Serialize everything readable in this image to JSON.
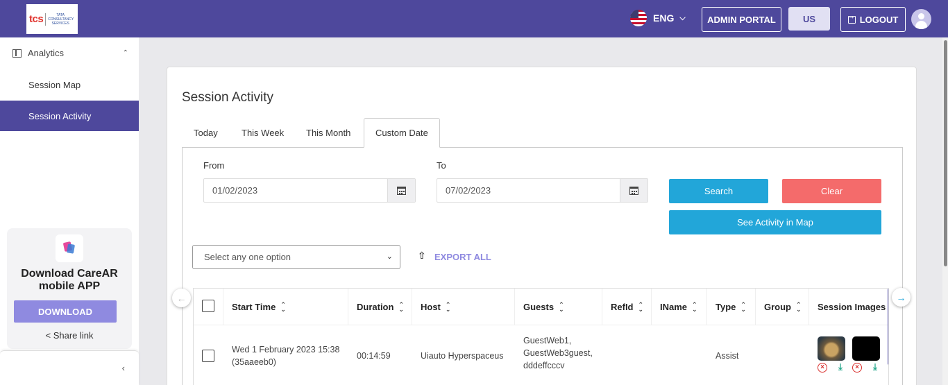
{
  "header": {
    "logo_brand": "tcs",
    "logo_tagline": "TATA CONSULTANCY SERVICES",
    "language": "ENG",
    "admin_portal": "ADMIN PORTAL",
    "region": "US",
    "logout": "LOGOUT"
  },
  "sidebar": {
    "section": "Analytics",
    "items": [
      {
        "label": "Session Map"
      },
      {
        "label": "Session Activity"
      }
    ],
    "promo_title": "Download CareAR mobile APP",
    "download_label": "DOWNLOAD",
    "share_label": "Share link"
  },
  "main": {
    "title": "Session Activity",
    "tabs": [
      {
        "label": "Today"
      },
      {
        "label": "This Week"
      },
      {
        "label": "This Month"
      },
      {
        "label": "Custom Date"
      }
    ],
    "from_label": "From",
    "from_value": "01/02/2023",
    "to_label": "To",
    "to_value": "07/02/2023",
    "search_label": "Search",
    "clear_label": "Clear",
    "map_label": "See Activity in Map",
    "select_placeholder": "Select any one option",
    "export_label": "EXPORT ALL"
  },
  "table": {
    "columns": [
      "Start Time",
      "Duration",
      "Host",
      "Guests",
      "RefId",
      "IName",
      "Type",
      "Group",
      "Session Images"
    ],
    "rows": [
      {
        "start_time": "Wed 1 February 2023 15:38",
        "session_code": "(35aaeeb0)",
        "duration": "00:14:59",
        "host": "Uiauto Hyperspaceus",
        "guests_line1": "GuestWeb1,",
        "guests_line2": "GuestWeb3guest,",
        "guests_line3": "dddeffcccv",
        "refid": "",
        "iname": "",
        "type": "Assist",
        "group": ""
      }
    ]
  },
  "colors": {
    "primary": "#4e489c",
    "accent": "#22a6d9",
    "danger": "#f46b6b",
    "download": "#8f8ae0"
  }
}
